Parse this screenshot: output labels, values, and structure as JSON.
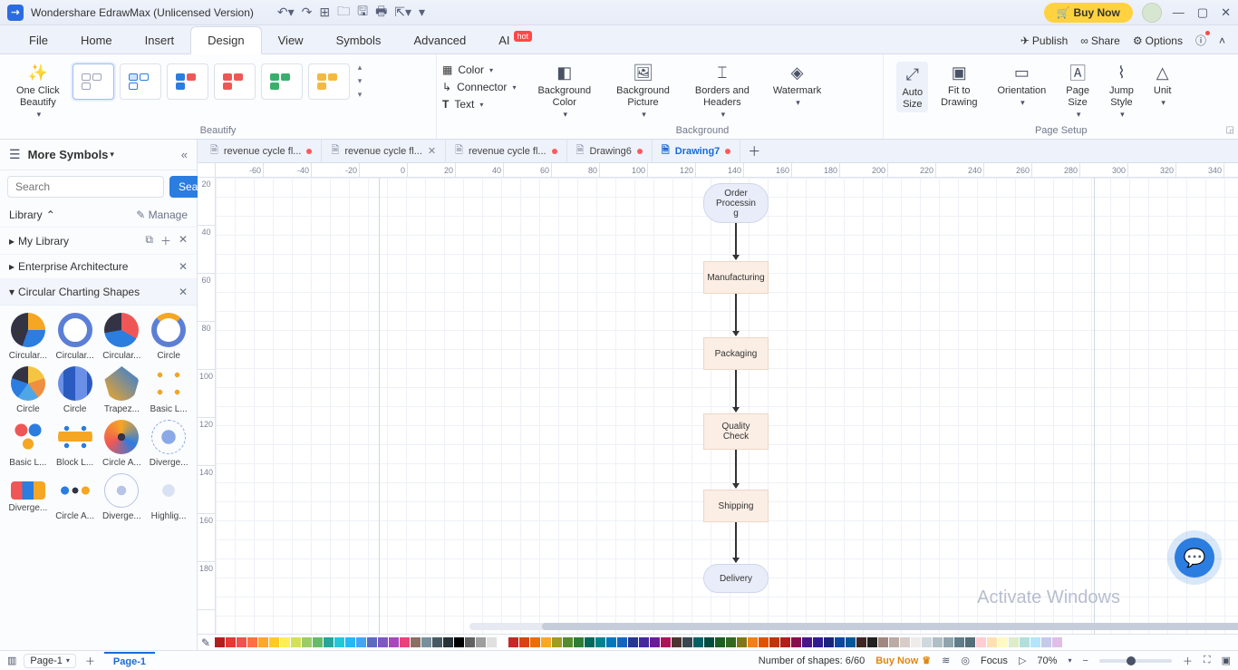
{
  "app_title": "Wondershare EdrawMax (Unlicensed Version)",
  "buy_now": "Buy Now",
  "menu": {
    "file": "File",
    "home": "Home",
    "insert": "Insert",
    "design": "Design",
    "view": "View",
    "symbols": "Symbols",
    "advanced": "Advanced",
    "ai": "AI",
    "hot": "hot"
  },
  "top_actions": {
    "publish": "Publish",
    "share": "Share",
    "options": "Options"
  },
  "ribbon": {
    "one_click": "One Click\nBeautify",
    "beautify": "Beautify",
    "color": "Color",
    "connector": "Connector",
    "text": "Text",
    "bg_color": "Background\nColor",
    "bg_pic": "Background\nPicture",
    "borders": "Borders and\nHeaders",
    "watermark": "Watermark",
    "background": "Background",
    "auto_size": "Auto\nSize",
    "fit": "Fit to\nDrawing",
    "orientation": "Orientation",
    "page_size": "Page\nSize",
    "jump": "Jump\nStyle",
    "unit": "Unit",
    "page_setup": "Page Setup"
  },
  "sidebar": {
    "title": "More Symbols",
    "search_ph": "Search",
    "search_btn": "Search",
    "library": "Library",
    "manage": "Manage",
    "my_library": "My Library",
    "enterprise": "Enterprise Architecture",
    "circular": "Circular Charting Shapes",
    "shapes": [
      "Circular...",
      "Circular...",
      "Circular...",
      "Circle",
      "Circle",
      "Circle",
      "Trapez...",
      "Basic L...",
      "Basic L...",
      "Block L...",
      "Circle A...",
      "Diverge...",
      "Diverge...",
      "Circle A...",
      "Diverge...",
      "Highlig..."
    ]
  },
  "tabs": [
    {
      "label": "revenue cycle fl...",
      "mod": true,
      "active": false,
      "close": false
    },
    {
      "label": "revenue cycle fl...",
      "mod": false,
      "active": false,
      "close": true
    },
    {
      "label": "revenue cycle fl...",
      "mod": true,
      "active": false,
      "close": false
    },
    {
      "label": "Drawing6",
      "mod": true,
      "active": false,
      "close": false
    },
    {
      "label": "Drawing7",
      "mod": true,
      "active": true,
      "close": false
    }
  ],
  "ruler_h": [
    "-60",
    "-40",
    "-20",
    "0",
    "20",
    "40",
    "60",
    "80",
    "100",
    "120",
    "140",
    "160",
    "180",
    "200",
    "220",
    "240",
    "260",
    "280",
    "300",
    "320",
    "340"
  ],
  "ruler_v": [
    "20",
    "40",
    "60",
    "80",
    "100",
    "120",
    "140",
    "160",
    "180"
  ],
  "flow": {
    "order": "Order\nProcessin\ng",
    "mfg": "Manufacturing",
    "pkg": "Packaging",
    "qc": "Quality\nCheck",
    "ship": "Shipping",
    "deliv": "Delivery"
  },
  "status": {
    "page": "Page-1",
    "page_tab": "Page-1",
    "shapes": "Number of shapes: 6/60",
    "buy": "Buy Now",
    "focus": "Focus",
    "zoom": "70%"
  },
  "watermark": "Activate Windows",
  "colors": [
    "#b31d1d",
    "#e53935",
    "#ef5350",
    "#ff7043",
    "#ffa726",
    "#ffca28",
    "#ffee58",
    "#d4e157",
    "#9ccc65",
    "#66bb6a",
    "#26a69a",
    "#26c6da",
    "#29b6f6",
    "#42a5f5",
    "#5c6bc0",
    "#7e57c2",
    "#ab47bc",
    "#ec407a",
    "#8d6e63",
    "#78909c",
    "#455a64",
    "#263238",
    "#000000",
    "#616161",
    "#9e9e9e",
    "#e0e0e0",
    "#ffffff",
    "#c62828",
    "#d84315",
    "#ef6c00",
    "#f9a825",
    "#9e9d24",
    "#558b2f",
    "#2e7d32",
    "#00695c",
    "#00838f",
    "#0277bd",
    "#1565c0",
    "#283593",
    "#4527a0",
    "#6a1b9a",
    "#ad1457",
    "#4e342e",
    "#37474f",
    "#006064",
    "#004d40",
    "#1b5e20",
    "#33691e",
    "#827717",
    "#f57f17",
    "#e65100",
    "#bf360c",
    "#b71c1c",
    "#880e4f",
    "#4a148c",
    "#311b92",
    "#1a237e",
    "#0d47a1",
    "#01579b",
    "#3e2723",
    "#212121",
    "#a1887f",
    "#bcaaa4",
    "#d7ccc8",
    "#efebe9",
    "#cfd8dc",
    "#b0bec5",
    "#90a4ae",
    "#607d8b",
    "#546e7a",
    "#ffcdd2",
    "#ffe0b2",
    "#fff9c4",
    "#dcedc8",
    "#b2dfdb",
    "#b3e5fc",
    "#c5cae9",
    "#e1bee7"
  ]
}
